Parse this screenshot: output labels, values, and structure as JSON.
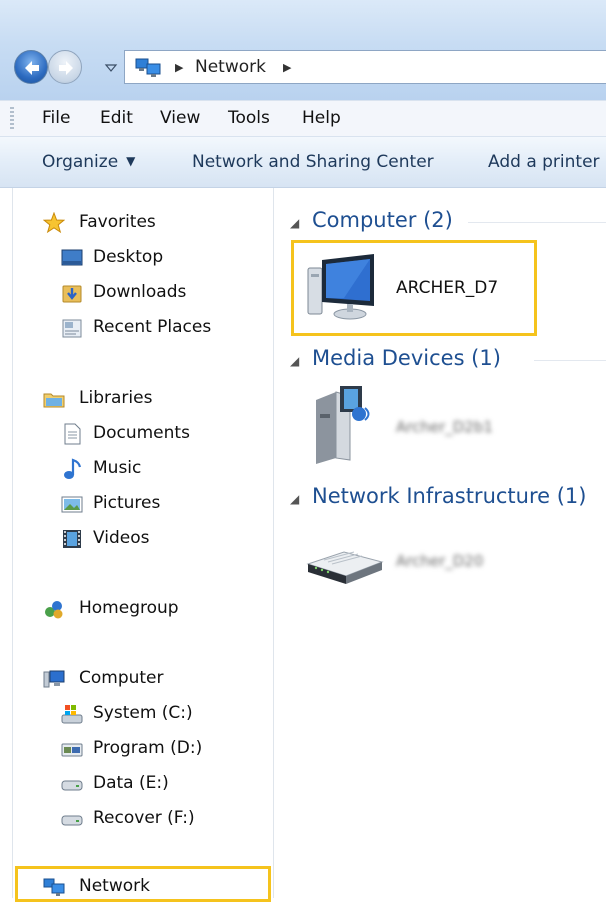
{
  "address": {
    "crumbs": [
      "Network"
    ],
    "icons": [
      "back-arrow-icon",
      "forward-arrow-icon",
      "network-icon"
    ]
  },
  "menu": {
    "items": [
      "File",
      "Edit",
      "View",
      "Tools",
      "Help"
    ]
  },
  "commands": {
    "organize": "Organize",
    "network_sharing": "Network and Sharing Center",
    "add_printer": "Add a printer"
  },
  "navigation": {
    "favorites": {
      "label": "Favorites",
      "items": [
        "Desktop",
        "Downloads",
        "Recent Places"
      ]
    },
    "libraries": {
      "label": "Libraries",
      "items": [
        "Documents",
        "Music",
        "Pictures",
        "Videos"
      ]
    },
    "homegroup": "Homegroup",
    "computer": {
      "label": "Computer",
      "items": [
        "System (C:)",
        "Program (D:)",
        "Data (E:)",
        "Recover (F:)"
      ]
    },
    "network": "Network"
  },
  "groups": [
    {
      "label": "Computer (2)",
      "devices": [
        {
          "name": "ARCHER_D7",
          "icon": "computer-monitor-icon",
          "highlighted": true
        }
      ]
    },
    {
      "label": "Media Devices (1)",
      "devices": [
        {
          "name": "Archer_D2b1",
          "icon": "media-device-icon",
          "blurred": true
        }
      ]
    },
    {
      "label": "Network Infrastructure (1)",
      "devices": [
        {
          "name": "Archer_D20",
          "icon": "router-icon",
          "blurred": true
        }
      ]
    }
  ],
  "colors": {
    "highlight_border": "#f5c31d",
    "group_header": "#1e4f91",
    "command_text": "#1e395b"
  }
}
